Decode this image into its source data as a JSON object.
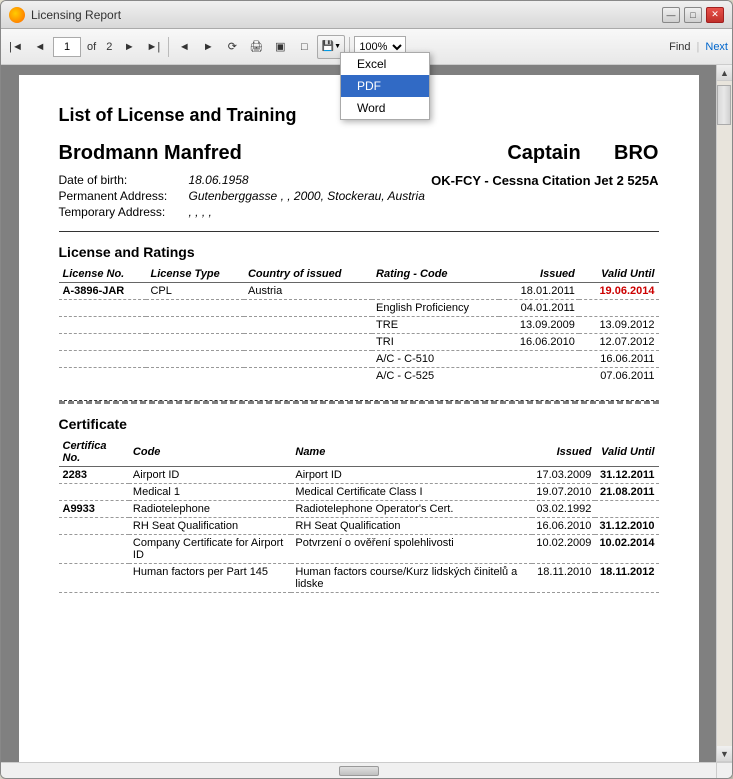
{
  "window": {
    "title": "Licensing Report"
  },
  "toolbar": {
    "page_current": "1",
    "page_total": "2",
    "zoom": "100%",
    "find_label": "Find",
    "next_label": "Next"
  },
  "dropdown": {
    "items": [
      "Excel",
      "PDF",
      "Word"
    ],
    "selected": "PDF"
  },
  "report": {
    "title": "List of License and Training",
    "person": {
      "name": "Brodmann Manfred",
      "role": "Captain",
      "code": "BRO",
      "dob_label": "Date of birth:",
      "dob_value": "18.06.1958",
      "aircraft": "OK-FCY - Cessna Citation Jet 2 525A",
      "perm_label": "Permanent Address:",
      "perm_value": "Gutenberggasse , , 2000, Stockerau, Austria",
      "temp_label": "Temporary Address:",
      "temp_value": ", , , ,"
    },
    "license_section": {
      "title": "License and Ratings",
      "headers": [
        "License No.",
        "License Type",
        "Country of issued",
        "Rating - Code",
        "Issued",
        "Valid Until"
      ],
      "rows": [
        {
          "license_no": "A-3896-JAR",
          "license_type": "CPL",
          "country": "Austria",
          "rating_code": "",
          "issued": "18.01.2011",
          "valid_until": "19.06.2014",
          "bold_valid": true
        },
        {
          "license_no": "",
          "license_type": "",
          "country": "",
          "rating_code": "English Proficiency",
          "issued": "04.01.2011",
          "valid_until": "",
          "bold_valid": false
        },
        {
          "license_no": "",
          "license_type": "",
          "country": "",
          "rating_code": "TRE",
          "issued": "13.09.2009",
          "valid_until": "13.09.2012",
          "bold_valid": false
        },
        {
          "license_no": "",
          "license_type": "",
          "country": "",
          "rating_code": "TRI",
          "issued": "16.06.2010",
          "valid_until": "12.07.2012",
          "bold_valid": false
        },
        {
          "license_no": "",
          "license_type": "",
          "country": "",
          "rating_code": "A/C - C-510",
          "issued": "",
          "valid_until": "16.06.2011",
          "bold_valid": false
        },
        {
          "license_no": "",
          "license_type": "",
          "country": "",
          "rating_code": "A/C - C-525",
          "issued": "",
          "valid_until": "07.06.2011",
          "bold_valid": false
        }
      ]
    },
    "certificate_section": {
      "title": "Certificate",
      "headers": [
        "Certifica No.",
        "Code",
        "Name",
        "Issued",
        "Valid Until"
      ],
      "rows": [
        {
          "cert_no": "2283",
          "code": "Airport ID",
          "name": "Airport ID",
          "issued": "17.03.2009",
          "valid_until": "31.12.2011",
          "bold_cert": true
        },
        {
          "cert_no": "",
          "code": "Medical 1",
          "name": "Medical Certificate Class I",
          "issued": "19.07.2010",
          "valid_until": "21.08.2011",
          "bold_cert": false
        },
        {
          "cert_no": "A9933",
          "code": "Radiotelephone",
          "name": "Radiotelephone Operator's Cert.",
          "issued": "03.02.1992",
          "valid_until": "",
          "bold_cert": true
        },
        {
          "cert_no": "",
          "code": "RH Seat Qualification",
          "name": "RH Seat Qualification",
          "issued": "16.06.2010",
          "valid_until": "31.12.2010",
          "bold_cert": false
        },
        {
          "cert_no": "",
          "code": "Company Certificate for Airport ID",
          "name": "Potvrzení o ověření spolehlivosti",
          "issued": "10.02.2009",
          "valid_until": "10.02.2014",
          "bold_cert": false
        },
        {
          "cert_no": "",
          "code": "Human factors per Part 145",
          "name": "Human factors course/Kurz lidských činitelů a lidske",
          "issued": "18.11.2010",
          "valid_until": "18.11.2012",
          "bold_cert": false
        }
      ]
    }
  }
}
